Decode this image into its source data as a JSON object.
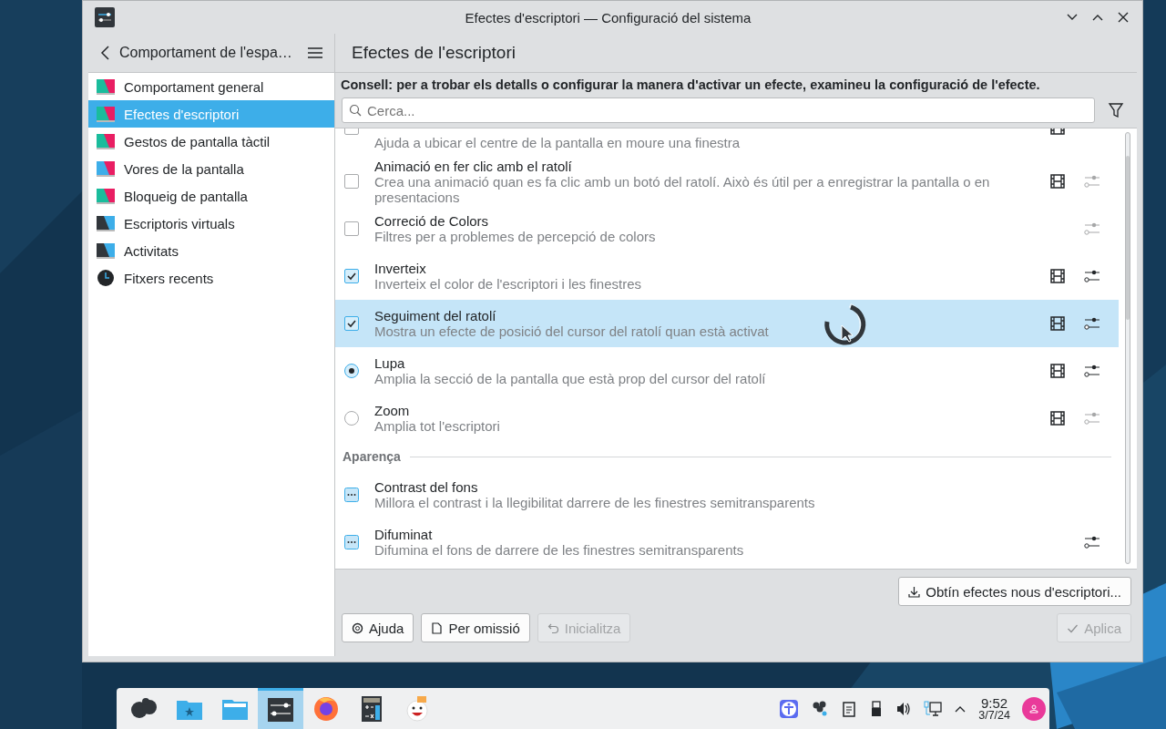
{
  "window": {
    "title": "Efectes d'escriptori — Configuració del sistema"
  },
  "sidebar": {
    "title": "Comportament de l'espa…",
    "items": [
      {
        "label": "Comportament general",
        "selected": false
      },
      {
        "label": "Efectes d'escriptori",
        "selected": true
      },
      {
        "label": "Gestos de pantalla tàctil",
        "selected": false
      },
      {
        "label": "Vores de la pantalla",
        "selected": false
      },
      {
        "label": "Bloqueig de pantalla",
        "selected": false
      },
      {
        "label": "Escriptoris virtuals",
        "selected": false
      },
      {
        "label": "Activitats",
        "selected": false
      },
      {
        "label": "Fitxers recents",
        "selected": false
      }
    ]
  },
  "page": {
    "title": "Efectes de l'escriptori",
    "hint": "Consell: per a trobar els detalls o configurar la manera d'activar un efecte, examineu la configuració de l'efecte.",
    "search": {
      "placeholder": "Cerca..."
    }
  },
  "effects": [
    {
      "kind": "checkbox",
      "description": "Ajuda a ubicar el centre de la pantalla en moure una finestra",
      "checked": false,
      "selected": false,
      "video": true
    },
    {
      "kind": "checkbox",
      "title": "Animació en fer clic amb el ratolí",
      "description": "Crea una animació quan es fa clic amb un botó del ratolí. Això és útil per a enregistrar la pantalla o en presentacions",
      "checked": false,
      "selected": false,
      "video": true,
      "configure": {
        "disabled": true
      }
    },
    {
      "kind": "checkbox",
      "title": "Correció de Colors",
      "description": "Filtres per a problemes de percepció de colors",
      "checked": false,
      "selected": false,
      "video": false,
      "configure": {
        "disabled": true
      }
    },
    {
      "kind": "checkbox",
      "title": "Inverteix",
      "description": "Inverteix el color de l'escriptori i les finestres",
      "checked": true,
      "selected": false,
      "video": true,
      "configure": {
        "disabled": false
      }
    },
    {
      "kind": "checkbox",
      "title": "Seguiment del ratolí",
      "description": "Mostra un efecte de posició del cursor del ratolí quan està activat",
      "checked": true,
      "selected": true,
      "video": true,
      "configure": {
        "disabled": false
      }
    },
    {
      "kind": "radio",
      "title": "Lupa",
      "description": "Amplia la secció de la pantalla que està prop del cursor del ratolí",
      "checked": true,
      "selected": false,
      "video": true,
      "configure": {
        "disabled": false
      }
    },
    {
      "kind": "radio",
      "title": "Zoom",
      "description": "Amplia tot l'escriptori",
      "checked": false,
      "selected": false,
      "video": true,
      "configure": {
        "disabled": true
      }
    },
    {
      "kind": "heading",
      "label": "Aparença"
    },
    {
      "kind": "group",
      "title": "Contrast del fons",
      "description": "Millora el contrast i la llegibilitat darrere de les finestres semitransparents",
      "selected": false,
      "video": false
    },
    {
      "kind": "group",
      "title": "Difuminat",
      "description": "Difumina el fons de darrere de les finestres semitransparents",
      "selected": false,
      "video": false,
      "configure": {
        "disabled": false
      }
    }
  ],
  "footer": {
    "get_new": "Obtín efectes nous d'escriptori...",
    "buttons": [
      {
        "kind": "help",
        "label": "Ajuda",
        "disabled": false
      },
      {
        "kind": "defaults",
        "label": "Per omissió",
        "disabled": false
      },
      {
        "kind": "reset",
        "label": "Inicialitza",
        "disabled": true
      },
      {
        "kind": "apply",
        "label": "Aplica",
        "disabled": true
      }
    ]
  },
  "taskbar": {
    "apps": [
      {
        "selected": false
      },
      {
        "selected": false
      },
      {
        "selected": false
      },
      {
        "selected": true
      },
      {
        "selected": false
      },
      {
        "selected": false
      },
      {
        "selected": false
      }
    ],
    "clock": {
      "time": "9:52",
      "date": "3/7/24"
    }
  }
}
